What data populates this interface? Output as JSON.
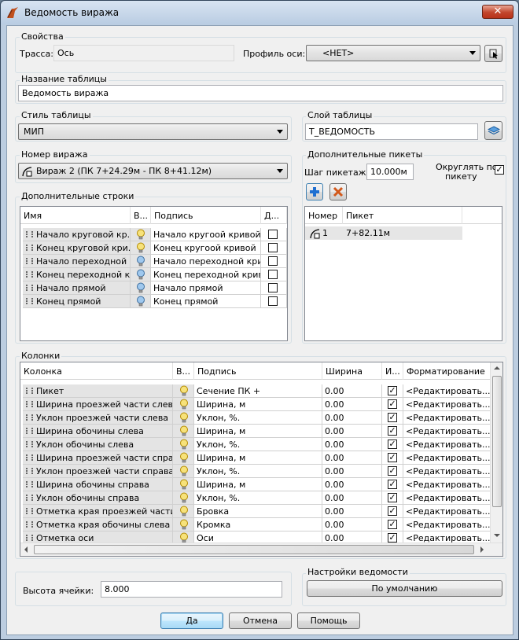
{
  "window": {
    "title": "Ведомость виража",
    "close_glyph": "✕"
  },
  "properties": {
    "group_label": "Свойства",
    "trassa_label": "Трасса:",
    "trassa_value": "Ось",
    "profile_label": "Профиль оси:",
    "profile_value": "<НЕТ>"
  },
  "table_name": {
    "group_label": "Название таблицы",
    "value": "Ведомость виража"
  },
  "table_style": {
    "group_label": "Стиль таблицы",
    "value": "МИП"
  },
  "table_layer": {
    "group_label": "Слой таблицы",
    "value": "Т_ВЕДОМОСТЬ"
  },
  "curve_number": {
    "group_label": "Номер виража",
    "value": "Вираж 2 (ПК 7+24.29м - ПК 8+41.12м)"
  },
  "extra_stations": {
    "group_label": "Дополнительные пикеты",
    "step_label": "Шаг пикетажа:",
    "step_value": "10.000м",
    "round_label_1": "Округлять по",
    "round_label_2": "пикету",
    "round_checked": "✓",
    "headers": [
      "Номер",
      "Пикет"
    ],
    "rows": [
      {
        "num": "1",
        "station": "7+82.11м"
      }
    ]
  },
  "extra_rows": {
    "group_label": "Дополнительные строки",
    "headers": [
      "Имя",
      "В...",
      "Подпись",
      "Д..."
    ],
    "rows": [
      {
        "name": "Начало круговой кр...",
        "sign": "Начало кругоой кривой",
        "bulb": "yellow"
      },
      {
        "name": "Конец круговой кри...",
        "sign": "Конец кругоой кривой",
        "bulb": "yellow"
      },
      {
        "name": "Начало переходной ...",
        "sign": "Начало переходной крив...",
        "bulb": "blue"
      },
      {
        "name": "Конец переходной к...",
        "sign": "Конец переходной кривой",
        "bulb": "blue"
      },
      {
        "name": "Начало прямой",
        "sign": "Начало прямой",
        "bulb": "blue"
      },
      {
        "name": "Конец прямой",
        "sign": "Конец прямой",
        "bulb": "blue"
      }
    ]
  },
  "columns": {
    "group_label": "Колонки",
    "headers": [
      "Колонка",
      "В...",
      "Подпись",
      "Ширина",
      "И...",
      "Форматирование"
    ],
    "check_glyph": "✓",
    "rows": [
      {
        "name": "Пикет",
        "sign": "Сечение ПК +",
        "width": "0.00",
        "fmt": "<Редактировать...>"
      },
      {
        "name": "Ширина проезжей части слева",
        "sign": "Ширина, м",
        "width": "0.00",
        "fmt": "<Редактировать...>"
      },
      {
        "name": "Уклон проезжей части слева",
        "sign": "Уклон, %.",
        "width": "0.00",
        "fmt": "<Редактировать...>"
      },
      {
        "name": "Ширина обочины слева",
        "sign": "Ширина, м",
        "width": "0.00",
        "fmt": "<Редактировать...>"
      },
      {
        "name": "Уклон обочины слева",
        "sign": "Уклон, %.",
        "width": "0.00",
        "fmt": "<Редактировать...>"
      },
      {
        "name": "Ширина проезжей части справа",
        "sign": "Ширина, м",
        "width": "0.00",
        "fmt": "<Редактировать...>"
      },
      {
        "name": "Уклон проезжей части справа",
        "sign": "Уклон, %.",
        "width": "0.00",
        "fmt": "<Редактировать...>"
      },
      {
        "name": "Ширина обочины справа",
        "sign": "Ширина, м",
        "width": "0.00",
        "fmt": "<Редактировать...>"
      },
      {
        "name": "Уклон обочины справа",
        "sign": "Уклон, %.",
        "width": "0.00",
        "fmt": "<Редактировать...>"
      },
      {
        "name": "Отметка края проезжей части ...",
        "sign": "Бровка",
        "width": "0.00",
        "fmt": "<Редактировать...>"
      },
      {
        "name": "Отметка края обочины слева",
        "sign": "Кромка",
        "width": "0.00",
        "fmt": "<Редактировать...>"
      },
      {
        "name": "Отметка оси",
        "sign": "Оси",
        "width": "0.00",
        "fmt": "<Редактировать...>"
      }
    ]
  },
  "cell_height": {
    "label": "Высота ячейки:",
    "value": "8.000"
  },
  "report_settings": {
    "group_label": "Настройки ведомости",
    "default_button": "По умолчанию"
  },
  "footer": {
    "ok": "Да",
    "cancel": "Отмена",
    "help": "Помощь"
  }
}
